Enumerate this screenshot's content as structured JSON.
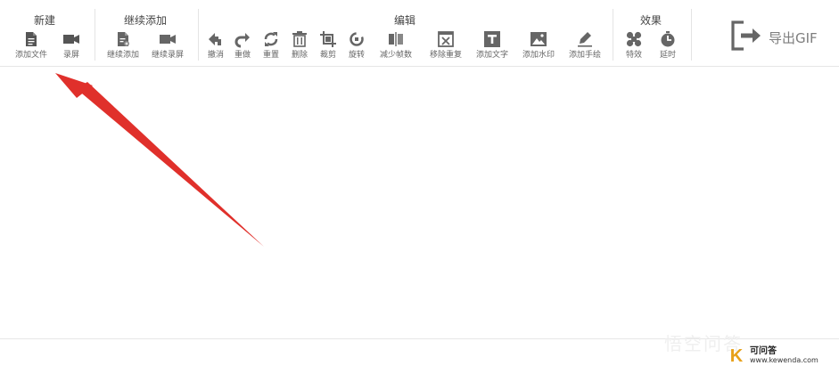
{
  "groups": {
    "new": {
      "title": "新建",
      "tools": [
        "添加文件",
        "录屏"
      ]
    },
    "continue": {
      "title": "继续添加",
      "tools": [
        "继续添加",
        "继续录屏"
      ]
    },
    "edit": {
      "title": "编辑",
      "tools": [
        "撤消",
        "重做",
        "重置",
        "删除",
        "裁剪",
        "旋转",
        "减少帧数",
        "移除重复",
        "添加文字",
        "添加水印",
        "添加手绘"
      ]
    },
    "effects": {
      "title": "效果",
      "tools": [
        "特效",
        "延时"
      ]
    }
  },
  "export": {
    "label": "导出GIF"
  },
  "watermark": {
    "brand_text": "可问答",
    "url": "www.kewenda.com",
    "ghost": "悟空问答"
  },
  "colors": {
    "arrow": "#e0302b",
    "icon": "#555555",
    "accent": "#e7a11b"
  }
}
